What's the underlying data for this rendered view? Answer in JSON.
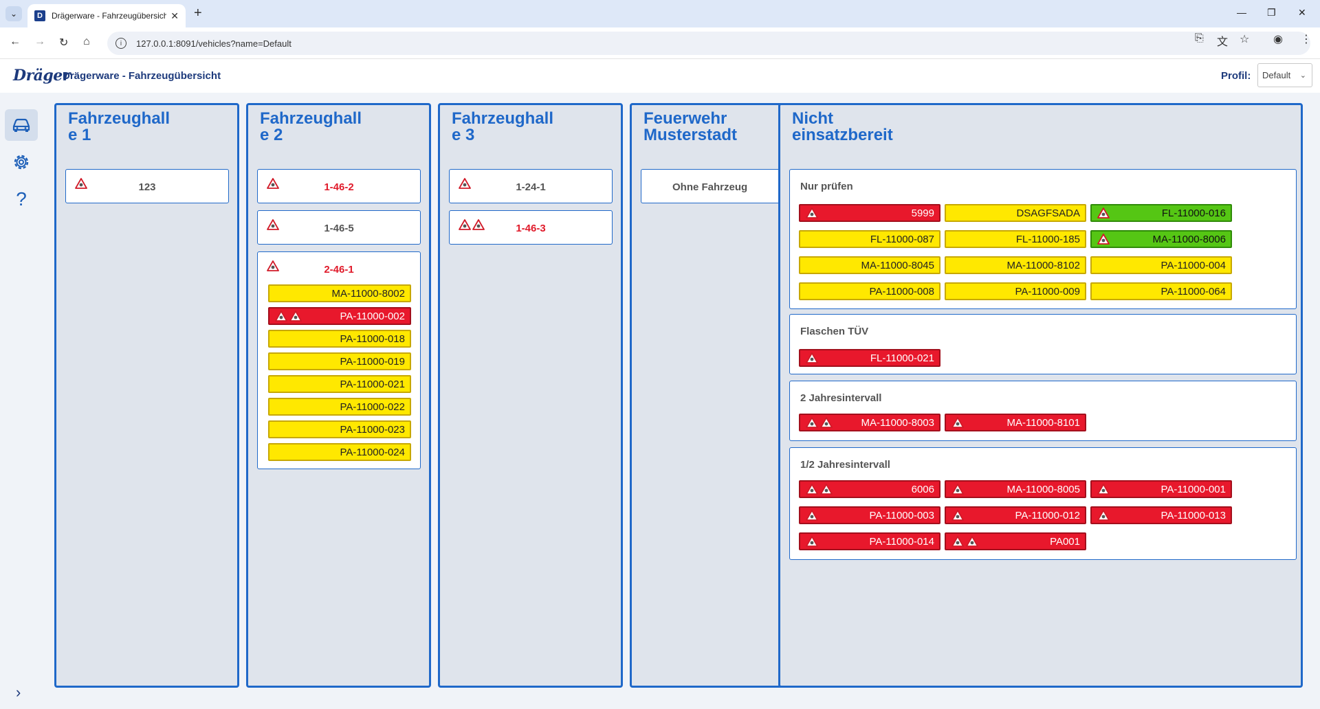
{
  "browser": {
    "tab_title": "Drägerware - Fahrzeugübersicht",
    "favicon_letter": "D",
    "url": "127.0.0.1:8091/vehicles?name=Default"
  },
  "header": {
    "logo": "Dräger",
    "title": "Drägerware - Fahrzeugübersicht",
    "profile_label": "Profil:",
    "profile_value": "Default"
  },
  "sidebar": {
    "items": [
      {
        "name": "vehicles",
        "icon": "car-icon",
        "active": true
      },
      {
        "name": "settings",
        "icon": "gear-icon",
        "active": false
      },
      {
        "name": "help",
        "icon": "question-icon",
        "active": false
      }
    ],
    "expand_icon": "chevron-right-icon"
  },
  "columns": {
    "c1": {
      "title_line1": "Fahrzeughall",
      "title_line2": "e 1",
      "v1": "123"
    },
    "c2": {
      "title_line1": "Fahrzeughall",
      "title_line2": "e 2",
      "v1": "1-46-2",
      "v2": "1-46-5",
      "v3": "2-46-1",
      "pills": [
        "MA-11000-8002",
        "PA-11000-002",
        "PA-11000-018",
        "PA-11000-019",
        "PA-11000-021",
        "PA-11000-022",
        "PA-11000-023",
        "PA-11000-024"
      ]
    },
    "c3": {
      "title_line1": "Fahrzeughall",
      "title_line2": "e 3",
      "v1": "1-24-1",
      "v2": "1-46-3"
    },
    "c4": {
      "title_line1": "Feuerwehr",
      "title_line2": "Musterstadt",
      "v1": "Ohne Fahrzeug"
    },
    "c5": {
      "title_line1": "Nicht",
      "title_line2": "einsatzbereit",
      "g1": {
        "title": "Nur prüfen",
        "items": [
          "5999",
          "DSAGFSADA",
          "FL-11000-016",
          "FL-11000-087",
          "FL-11000-185",
          "MA-11000-8006",
          "MA-11000-8045",
          "MA-11000-8102",
          "PA-11000-004",
          "PA-11000-008",
          "PA-11000-009",
          "PA-11000-064"
        ]
      },
      "g2": {
        "title": "Flaschen TÜV",
        "items": [
          "FL-11000-021"
        ]
      },
      "g3": {
        "title": "2 Jahresintervall",
        "items": [
          "MA-11000-8003",
          "MA-11000-8101"
        ]
      },
      "g4": {
        "title": "1/2 Jahresintervall",
        "items": [
          "6006",
          "MA-11000-8005",
          "PA-11000-001",
          "PA-11000-003",
          "PA-11000-012",
          "PA-11000-013",
          "PA-11000-014",
          "PA001"
        ]
      }
    }
  },
  "colors": {
    "accent": "#1f68c9",
    "yellow": "#ffe800",
    "red": "#e8182c",
    "green": "#55c614"
  }
}
